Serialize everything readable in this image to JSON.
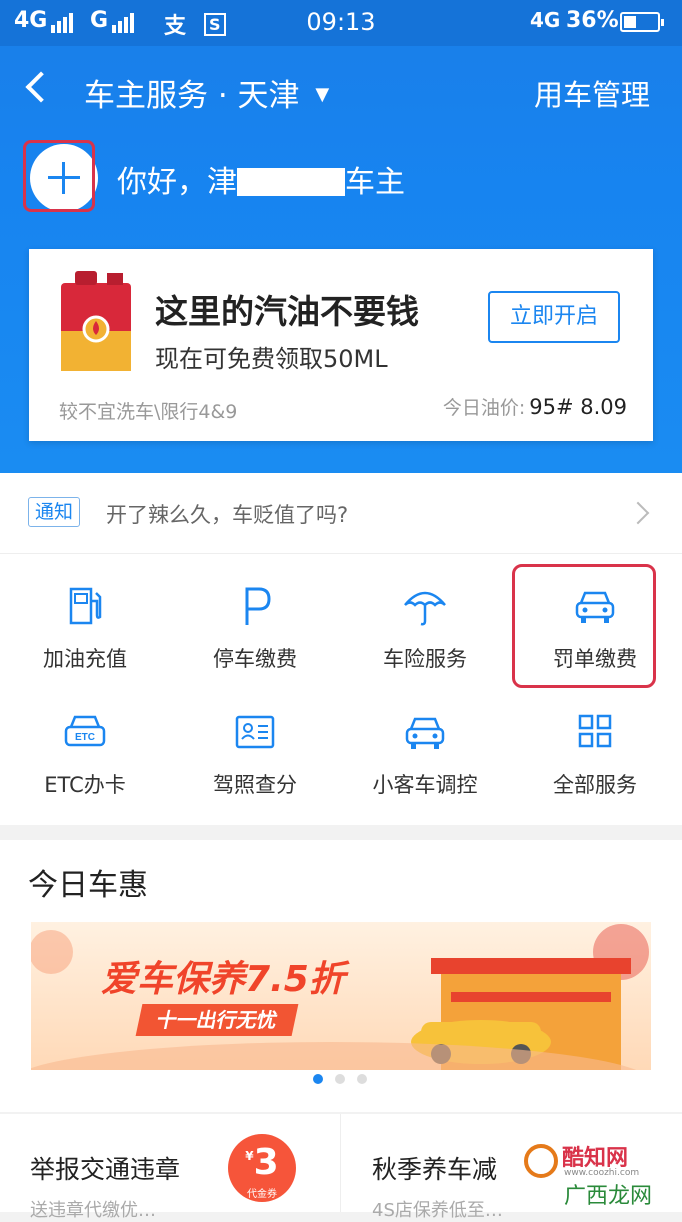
{
  "status_bar": {
    "signal1": "4G",
    "signal2": "G",
    "app_icons": [
      "支",
      "S"
    ],
    "time": "09:13",
    "network": "4G",
    "battery": "36%"
  },
  "nav": {
    "title": "车主服务 · 天津",
    "right_action": "用车管理"
  },
  "greeting": {
    "prefix": "你好，津",
    "suffix": "车主"
  },
  "promo": {
    "title": "这里的汽油不要钱",
    "subtitle": "现在可免费领取50ML",
    "button": "立即开启",
    "footer_left": "较不宜洗车\\限行4&9",
    "footer_right_label": "今日油价:",
    "footer_right_value": "95# 8.09"
  },
  "notice": {
    "tag": "通知",
    "text": "开了辣么久，车贬值了吗?"
  },
  "services": [
    {
      "label": "加油充值",
      "icon": "fuel-pump-icon"
    },
    {
      "label": "停车缴费",
      "icon": "parking-icon"
    },
    {
      "label": "车险服务",
      "icon": "umbrella-icon"
    },
    {
      "label": "罚单缴费",
      "icon": "car-icon"
    },
    {
      "label": "ETC办卡",
      "icon": "etc-car-icon"
    },
    {
      "label": "驾照查分",
      "icon": "id-card-icon"
    },
    {
      "label": "小客车调控",
      "icon": "car-icon"
    },
    {
      "label": "全部服务",
      "icon": "grid-icon"
    }
  ],
  "deals": {
    "title": "今日车惠",
    "banner_title": "爱车保养7.5折",
    "banner_sub": "十一出行无忧"
  },
  "bottom_cards": [
    {
      "title": "举报交通违章",
      "sub": "送违章代缴优…",
      "coupon_value": "3",
      "coupon_unit": "¥",
      "coupon_label": "代金券"
    },
    {
      "title": "秋季养车减",
      "sub": "4S店保养低至…"
    }
  ],
  "watermark": {
    "brand": "酷知网",
    "url": "www.coozhi.com",
    "brand2": "广西龙网"
  },
  "colors": {
    "primary": "#1b86f0",
    "highlight": "#d9334a"
  }
}
